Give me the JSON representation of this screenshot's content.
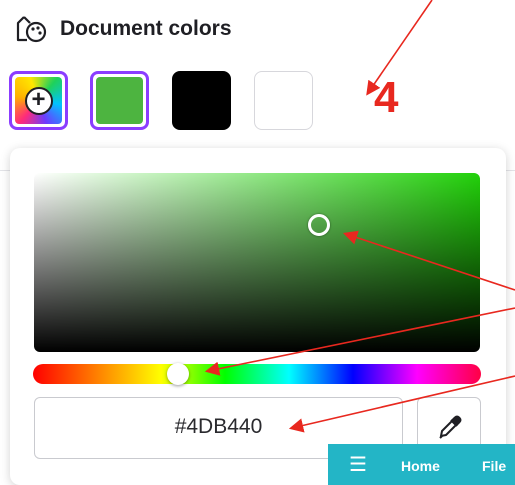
{
  "header": {
    "title": "Document colors",
    "icon": "palette-icon"
  },
  "swatches": [
    {
      "name": "add-color",
      "icon": "plus-icon",
      "selected": true
    },
    {
      "name": "green",
      "color": "#4DB440",
      "selected": true
    },
    {
      "name": "black",
      "color": "#000000",
      "selected": false
    },
    {
      "name": "white",
      "color": "#FFFFFF",
      "selected": false
    }
  ],
  "annotation": {
    "step_number": "4",
    "color": "#E8281F"
  },
  "color_picker": {
    "hex_value": "#4DB440",
    "eyedropper_icon": "eyedropper-icon"
  },
  "navbar": {
    "menu_icon": "☰",
    "items": [
      "Home",
      "File"
    ],
    "background": "#23B5C6"
  },
  "accent_color": "#8B3DFF"
}
